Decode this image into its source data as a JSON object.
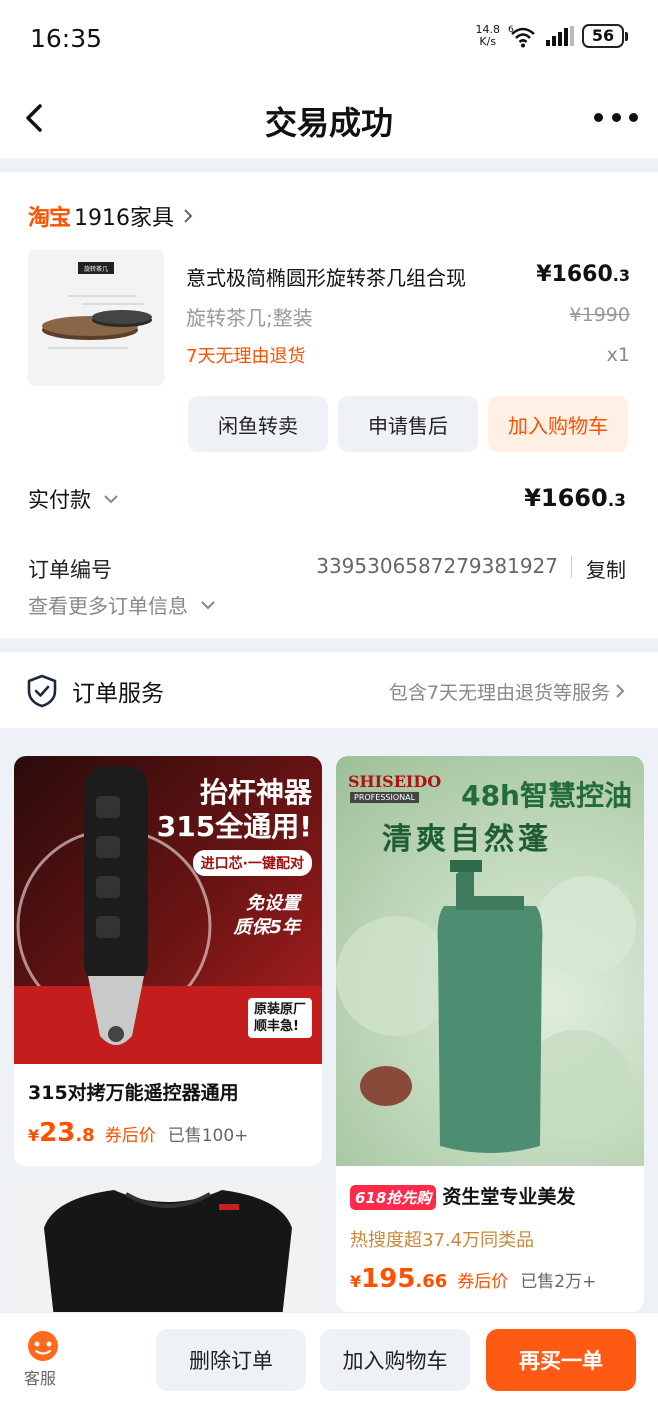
{
  "status": {
    "time": "16:35",
    "net_speed_value": "14.8",
    "net_speed_unit": "K/s",
    "network_tag": "6",
    "battery": "56"
  },
  "nav": {
    "title": "交易成功"
  },
  "shop": {
    "platform_logo": "淘宝",
    "name": "1916家具"
  },
  "product": {
    "image_caption": "旋转茶几",
    "title": "意式极简椭圆形旋转茶几组合现",
    "price_int": "¥1660",
    "price_dec": ".3",
    "spec": "旋转茶几;整装",
    "original_price": "¥1990",
    "return_policy": "7天无理由退货",
    "quantity": "x1"
  },
  "actions": {
    "resell": "闲鱼转卖",
    "after_sale": "申请售后",
    "add_cart": "加入购物车"
  },
  "payment": {
    "label": "实付款",
    "amount_int": "¥1660",
    "amount_dec": ".3"
  },
  "order": {
    "number_label": "订单编号",
    "number": "3395306587279381927",
    "copy": "复制",
    "more_info": "查看更多订单信息"
  },
  "service": {
    "title": "订单服务",
    "desc": "包含7天无理由退货等服务"
  },
  "feed": {
    "item1": {
      "headline": "抬杆神器",
      "headline2": "315全通用!",
      "tag": "进口芯·一键配对",
      "sub1": "免设置",
      "sub2": "质保5年",
      "badge1": "原装原厂",
      "badge2": "顺丰急!",
      "title": "315对拷万能遥控器通用",
      "price_sym": "¥",
      "price_int": "23",
      "price_dec": ".8",
      "coupon": "券后价",
      "sold": "已售100+"
    },
    "item2": {
      "brand": "SHISEIDO",
      "brand_sub": "PROFESSIONAL",
      "headline": "48h智慧控油",
      "headline2": "清爽自然蓬",
      "promo_tag": "618抢先购",
      "title": "资生堂专业美发",
      "hot": "热搜度超37.4万同类品",
      "price_sym": "¥",
      "price_int": "195",
      "price_dec": ".66",
      "coupon": "券后价",
      "sold": "已售2万+"
    }
  },
  "bottom": {
    "cs": "客服",
    "delete": "删除订单",
    "add_cart": "加入购物车",
    "rebuy": "再买一单"
  },
  "colors": {
    "accent": "#ff5000",
    "bg": "#eef1f6",
    "button_gray": "#eef2f6"
  }
}
